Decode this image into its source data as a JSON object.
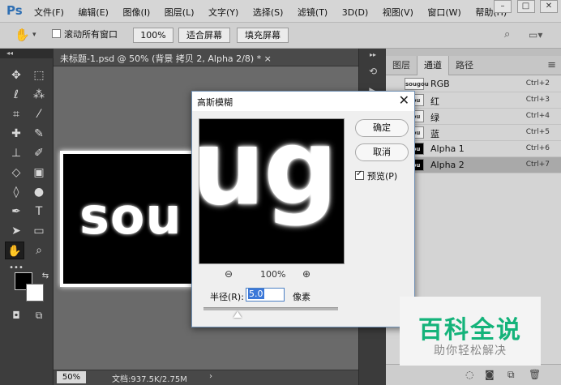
{
  "app": {
    "logo": "Ps"
  },
  "menu": [
    "文件(F)",
    "编辑(E)",
    "图像(I)",
    "图层(L)",
    "文字(Y)",
    "选择(S)",
    "滤镜(T)",
    "3D(D)",
    "视图(V)",
    "窗口(W)",
    "帮助(H)"
  ],
  "window_controls": {
    "minimize": "–",
    "restore": "□",
    "close": "✕"
  },
  "options": {
    "scroll_all_label": "滚动所有窗口",
    "zoom_percent": "100%",
    "fit_screen": "适合屏幕",
    "fill_screen": "填充屏幕"
  },
  "document": {
    "tab_title": "未标题-1.psd @ 50% (背景 拷贝 2, Alpha 2/8) *",
    "tab_close": "×",
    "canvas_text": "sou",
    "zoom": "50%",
    "doc_info": "文档:937.5K/2.75M",
    "status_arrow": "›"
  },
  "panel": {
    "tabs": [
      "图层",
      "通道",
      "路径"
    ],
    "active_tab": "通道",
    "channels": [
      {
        "name": "RGB",
        "shortcut": "Ctrl+2",
        "thumb": "sougou",
        "thumb_style": "light",
        "selected": false
      },
      {
        "name": "红",
        "shortcut": "Ctrl+3",
        "thumb": "gou",
        "thumb_style": "light",
        "selected": false
      },
      {
        "name": "绿",
        "shortcut": "Ctrl+4",
        "thumb": "gou",
        "thumb_style": "light",
        "selected": false
      },
      {
        "name": "蓝",
        "shortcut": "Ctrl+5",
        "thumb": "gou",
        "thumb_style": "light",
        "selected": false
      },
      {
        "name": "Alpha 1",
        "shortcut": "Ctrl+6",
        "thumb": "gou",
        "thumb_style": "dark",
        "selected": false
      },
      {
        "name": "Alpha 2",
        "shortcut": "Ctrl+7",
        "thumb": "gou",
        "thumb_style": "dark",
        "selected": true
      }
    ]
  },
  "dialog": {
    "title": "高斯模糊",
    "close": "✕",
    "ok": "确定",
    "cancel": "取消",
    "preview_label": "预览(P)",
    "preview_checked": true,
    "preview_text": "ug",
    "zoom_out": "⊖",
    "zoom_level": "100%",
    "zoom_in": "⊕",
    "radius_label": "半径(R):",
    "radius_value": "5.0",
    "radius_unit": "像素",
    "radius_slider_fraction": 0.25
  },
  "watermark": {
    "title": "百科全说",
    "subtitle": "助你轻松解决"
  },
  "colors": {
    "accent": "#2f6fb3",
    "watermark_green": "#14b37a",
    "selection": "#3b78d8"
  }
}
